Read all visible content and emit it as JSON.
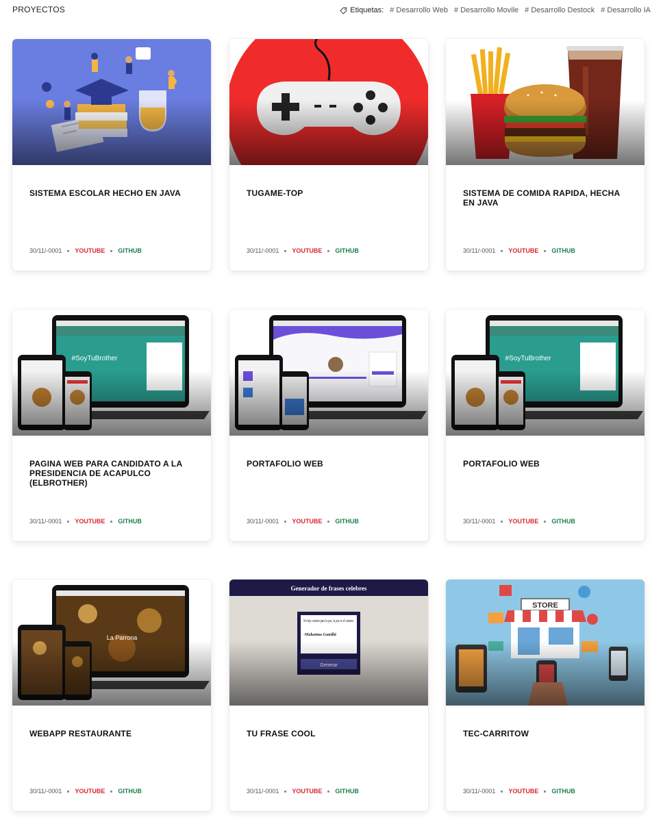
{
  "header": {
    "title": "PROYECTOS",
    "tags_label": "Etiquetas:",
    "tags": [
      "# Desarrollo Web",
      "# Desarrollo Movile",
      "# Desarrollo Destock",
      "# Desarrollo IA"
    ]
  },
  "cards": [
    {
      "title": "SISTEMA ESCOLAR HECHO EN JAVA",
      "date": "30/11/-0001",
      "youtube": "YOUTUBE",
      "github": "GITHUB",
      "image": "education-illustration"
    },
    {
      "title": "TUGAME-TOP",
      "date": "30/11/-0001",
      "youtube": "YOUTUBE",
      "github": "GITHUB",
      "image": "gamepad-icon"
    },
    {
      "title": "SISTEMA DE COMIDA RAPIDA, HECHA EN JAVA",
      "date": "30/11/-0001",
      "youtube": "YOUTUBE",
      "github": "GITHUB",
      "image": "fast-food-photo"
    },
    {
      "title": "PAGINA WEB PARA CANDIDATO A LA PRESIDENCIA DE ACAPULCO (ELBROTHER)",
      "date": "30/11/-0001",
      "youtube": "YOUTUBE",
      "github": "GITHUB",
      "image": "devices-mockup",
      "screen_text": "#SoyTuBrother"
    },
    {
      "title": "PORTAFOLIO WEB",
      "date": "30/11/-0001",
      "youtube": "YOUTUBE",
      "github": "GITHUB",
      "image": "devices-mockup"
    },
    {
      "title": "PORTAFOLIO WEB",
      "date": "30/11/-0001",
      "youtube": "YOUTUBE",
      "github": "GITHUB",
      "image": "devices-mockup",
      "screen_text": "#SoyTuBrother"
    },
    {
      "title": "WEBAPP RESTAURANTE",
      "date": "30/11/-0001",
      "youtube": "YOUTUBE",
      "github": "GITHUB",
      "image": "devices-mockup",
      "screen_text": "La Parrona"
    },
    {
      "title": "TU FRASE COOL",
      "date": "30/11/-0001",
      "youtube": "YOUTUBE",
      "github": "GITHUB",
      "image": "quote-generator-screenshot",
      "screen_heading": "Generador de frases celebres",
      "screen_quote": "No hay camino para la paz, la paz es el camino.",
      "screen_author": "-Mahatma Gandhi",
      "screen_button": "Generar"
    },
    {
      "title": "TEC-CARRITOW",
      "date": "30/11/-0001",
      "youtube": "YOUTUBE",
      "github": "GITHUB",
      "image": "store-illustration",
      "screen_text": "STORE"
    }
  ],
  "colors": {
    "youtube": "#d9272e",
    "github": "#1a7f4b"
  }
}
